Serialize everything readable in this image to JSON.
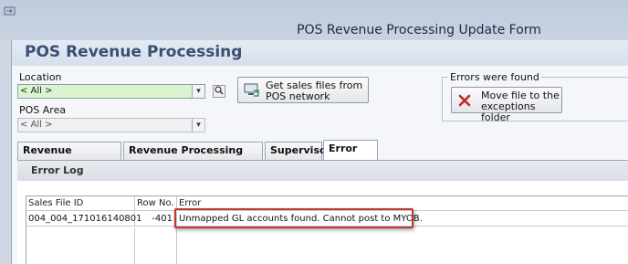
{
  "window": {
    "title": "POS Revenue Processing Update Form",
    "icon": "app-window-icon"
  },
  "header": {
    "app_title": "POS Revenue Processing"
  },
  "filters": {
    "location_label": "Location",
    "location_value": "< All >",
    "pos_area_label": "POS Area",
    "pos_area_value": "< All >"
  },
  "actions": {
    "get_sales_files_label": "Get sales files from POS network",
    "errors_group_title": "Errors were found",
    "move_file_label": "Move file to the exceptions folder"
  },
  "tabs": [
    {
      "label": "Revenue Processing",
      "active": false
    },
    {
      "label": "Revenue Processing Options",
      "active": false
    },
    {
      "label": "Supervisor",
      "active": false
    },
    {
      "label": "Error log",
      "active": true
    }
  ],
  "error_log": {
    "title": "Error Log",
    "columns": [
      "Sales File ID",
      "Row No.",
      "Error"
    ],
    "rows": [
      {
        "sales_file_id": "004_004_171016140801",
        "row_no": "-401",
        "error": "Unmapped GL accounts found. Cannot post to MYOB."
      }
    ]
  },
  "colors": {
    "accent_title": "#3b4f74",
    "highlight_border": "#c0392b",
    "location_field_bg": "#d8f5d0"
  }
}
